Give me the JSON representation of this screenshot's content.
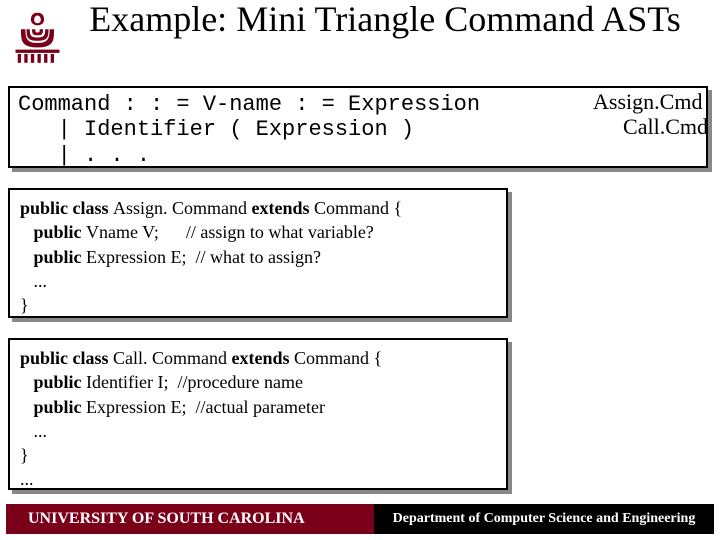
{
  "title": "Example: Mini Triangle Command ASTs",
  "grammar": {
    "line1": "Command : : = V-name : = Expression",
    "line2": "   | Identifier ( Expression )",
    "line3": "   | . . .",
    "label1": "Assign.Cmd",
    "label2": "Call.Cmd"
  },
  "code1": {
    "l1a": "public class ",
    "l1b": "Assign. Command ",
    "l1c": "extends ",
    "l1d": "Command {",
    "l2a": "   public ",
    "l2b": "Vname V;      // assign to what variable?",
    "l3a": "   public ",
    "l3b": "Expression E;  // what to assign?",
    "l4": "   ...",
    "l5": "}"
  },
  "code2": {
    "l1a": "public class ",
    "l1b": "Call. Command ",
    "l1c": "extends ",
    "l1d": "Command {",
    "l2a": "   public ",
    "l2b": "Identifier I;  //procedure name",
    "l3a": "   public ",
    "l3b": "Expression E;  //actual parameter",
    "l4": "   ...",
    "l5": "}",
    "l6": "..."
  },
  "footer": {
    "left": "UNIVERSITY OF SOUTH CAROLINA",
    "right": "Department of Computer Science and Engineering"
  },
  "logo_color": "#7a0019"
}
